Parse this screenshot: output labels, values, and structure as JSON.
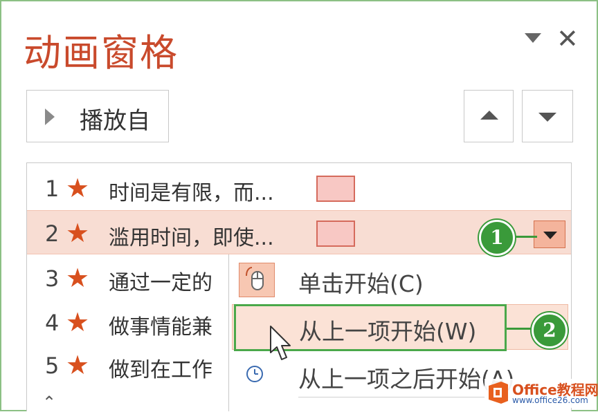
{
  "pane": {
    "title": "动画窗格",
    "close_glyph": "✕"
  },
  "toolbar": {
    "play_label": "播放自"
  },
  "animations": [
    {
      "index": "1",
      "text": "时间是有限，而..."
    },
    {
      "index": "2",
      "text": "滥用时间，即使..."
    },
    {
      "index": "3",
      "text": "通过一定的"
    },
    {
      "index": "4",
      "text": "做事情能兼"
    },
    {
      "index": "5",
      "text": "做到在工作"
    }
  ],
  "context_menu": {
    "items": [
      {
        "label": "单击开始(C)",
        "icon": "mouse-icon"
      },
      {
        "label": "从上一项开始(W)",
        "icon": "none"
      },
      {
        "label": "从上一项之后开始(A)",
        "icon": "clock-icon"
      }
    ]
  },
  "callouts": [
    "1",
    "2"
  ],
  "watermark": {
    "brand": "Office教程网",
    "url": "www.office26.com"
  },
  "colors": {
    "accent": "#d8501e",
    "selection": "#f8ddd3",
    "callout": "#3a9a3a"
  }
}
